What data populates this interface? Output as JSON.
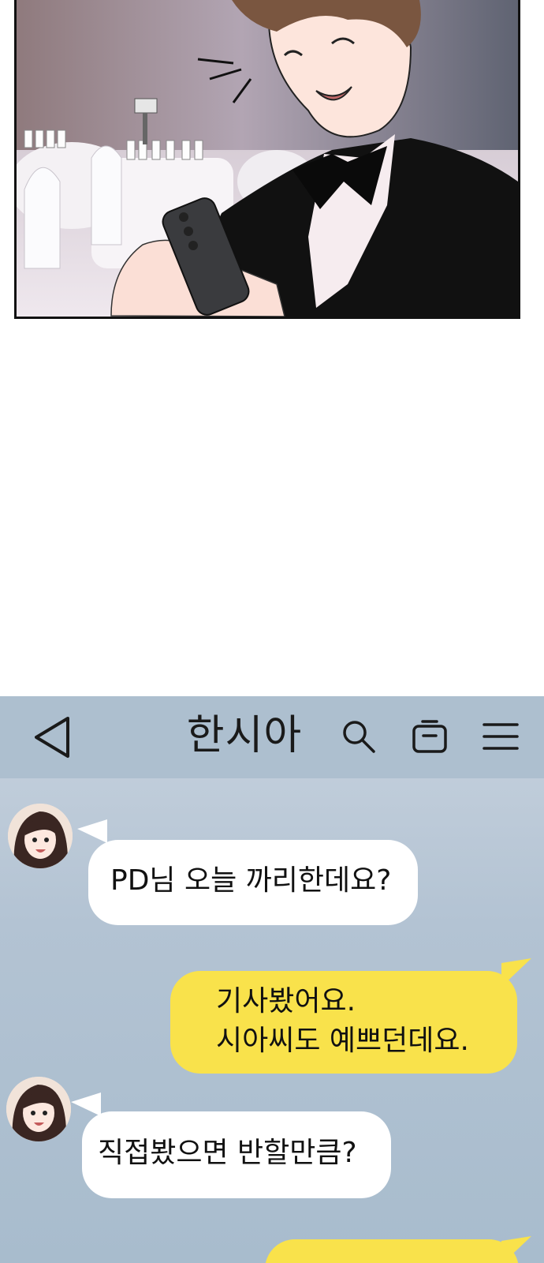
{
  "comic_panel": {
    "description_name": "man-in-tuxedo-reading-phone"
  },
  "chat": {
    "title": "한시아",
    "icons": {
      "back": "back-triangle-icon",
      "search": "search-icon",
      "inbox": "inbox-icon",
      "menu": "hamburger-menu-icon"
    },
    "colors": {
      "topbar": "#adbfcf",
      "incoming_bubble": "#ffffff",
      "outgoing_bubble": "#f9e24b"
    },
    "messages": [
      {
        "direction": "incoming",
        "text": "PD님 오늘 까리한데요?"
      },
      {
        "direction": "outgoing",
        "text": "기사봤어요.\n시아씨도 예쁘던데요."
      },
      {
        "direction": "incoming",
        "text": "직접봤으면 반할만큼?"
      },
      {
        "direction": "outgoing",
        "text": ""
      }
    ]
  }
}
